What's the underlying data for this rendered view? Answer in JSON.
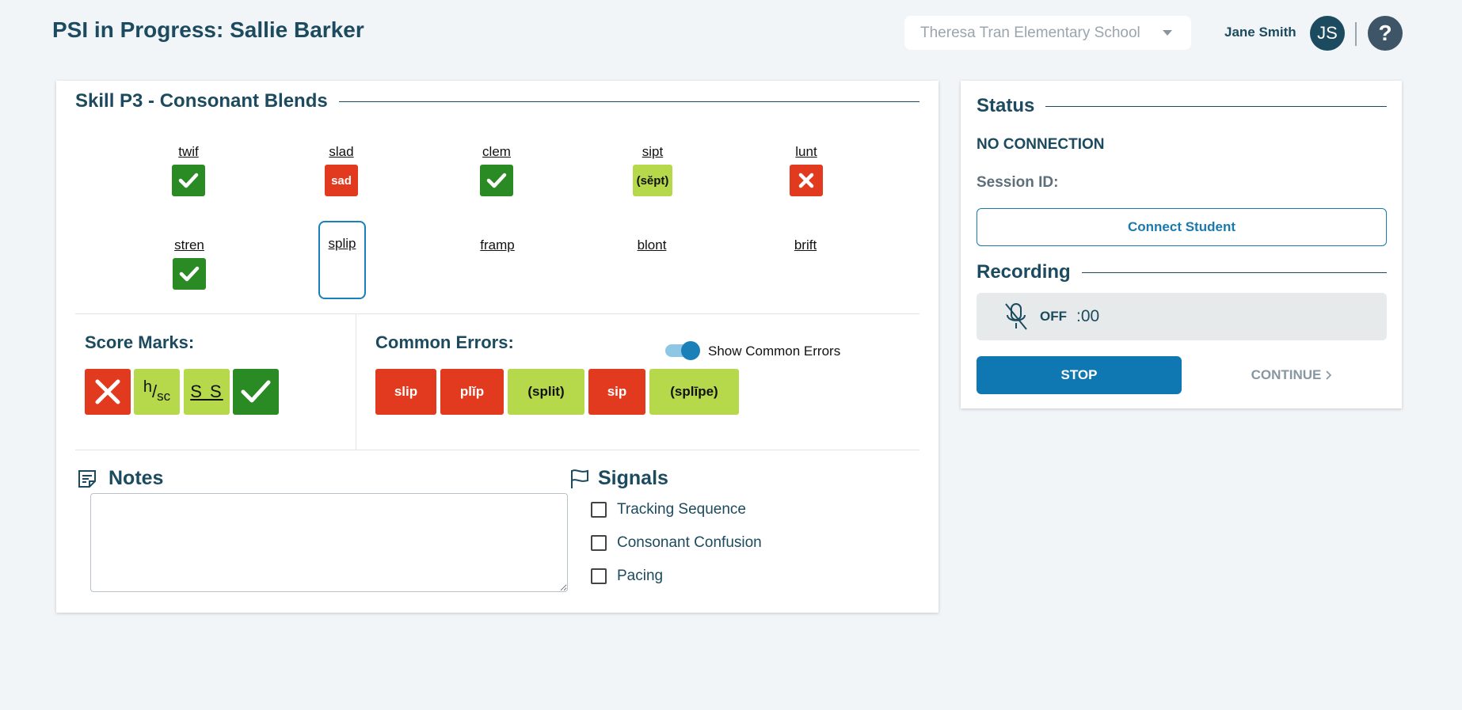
{
  "header": {
    "title": "PSI in Progress: Sallie Barker",
    "school_select": "Theresa Tran Elementary School",
    "user_name": "Jane Smith",
    "avatar_initials": "JS",
    "help_icon": "question-icon"
  },
  "skill": {
    "title": "Skill P3 - Consonant Blends",
    "words": [
      {
        "word": "twif",
        "mark": "check",
        "mark_text": ""
      },
      {
        "word": "slad",
        "mark": "error",
        "mark_text": "sad"
      },
      {
        "word": "clem",
        "mark": "check",
        "mark_text": ""
      },
      {
        "word": "sipt",
        "mark": "self-correct",
        "mark_text": "(sĕpt)"
      },
      {
        "word": "lunt",
        "mark": "incorrect",
        "mark_text": ""
      },
      {
        "word": "stren",
        "mark": "check",
        "mark_text": ""
      },
      {
        "word": "splip",
        "mark": "active",
        "mark_text": ""
      },
      {
        "word": "framp",
        "mark": "none",
        "mark_text": ""
      },
      {
        "word": "blont",
        "mark": "none",
        "mark_text": ""
      },
      {
        "word": "brift",
        "mark": "none",
        "mark_text": ""
      }
    ]
  },
  "score_marks": {
    "title": "Score Marks:",
    "buttons": [
      "incorrect",
      "h/sc",
      "S S",
      "correct"
    ],
    "hsc_h": "h",
    "hsc_sc": "sc",
    "ss_label": "S S"
  },
  "common_errors": {
    "title": "Common Errors:",
    "toggle_label": "Show Common Errors",
    "toggle_on": true,
    "buttons": [
      {
        "label": "slip",
        "color": "#e23a1e"
      },
      {
        "label": "plĭp",
        "color": "#e23a1e"
      },
      {
        "label": "(split)",
        "color": "#b5d94a"
      },
      {
        "label": "sip",
        "color": "#e23a1e"
      },
      {
        "label": "(splīpe)",
        "color": "#b5d94a"
      }
    ]
  },
  "notes": {
    "title": "Notes",
    "value": ""
  },
  "signals": {
    "title": "Signals",
    "items": [
      "Tracking Sequence",
      "Consonant Confusion",
      "Pacing"
    ]
  },
  "status": {
    "title": "Status",
    "connection": "NO CONNECTION",
    "session_label": "Session ID:",
    "connect_label": "Connect Student"
  },
  "recording": {
    "title": "Recording",
    "state": "OFF",
    "time": ":00",
    "stop_label": "STOP",
    "continue_label": "CONTINUE"
  },
  "colors": {
    "primary": "#1c4a5e",
    "accent": "#0f78b2",
    "correct": "#2a8a23",
    "error": "#e23a1e",
    "self_correct": "#b5d94a"
  }
}
